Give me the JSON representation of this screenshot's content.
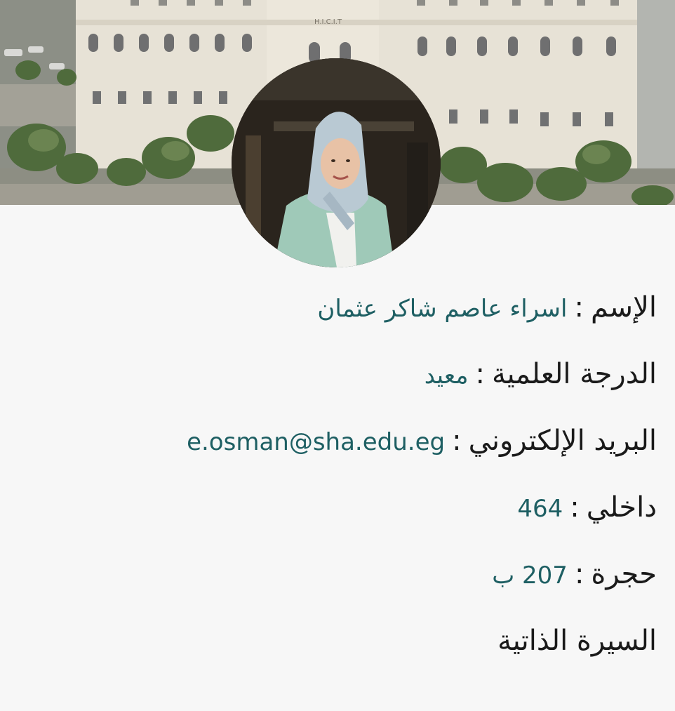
{
  "cover": {
    "building_sign": "H.I.C.I.T"
  },
  "profile": {
    "name_label": "الإسم",
    "name_value": "اسراء عاصم شاكر عثمان",
    "degree_label": "الدرجة العلمية",
    "degree_value": "معيد",
    "email_label": "البريد الإلكتروني",
    "email_value": "e.osman@sha.edu.eg",
    "extension_label": "داخلي",
    "extension_value": "464",
    "room_label": "حجرة",
    "room_value": "207 ب",
    "cv_link": "السيرة الذاتية",
    "separator": ":"
  },
  "colors": {
    "value_color": "#1e5f63",
    "label_color": "#1a1a1a",
    "background": "#f7f7f7"
  }
}
